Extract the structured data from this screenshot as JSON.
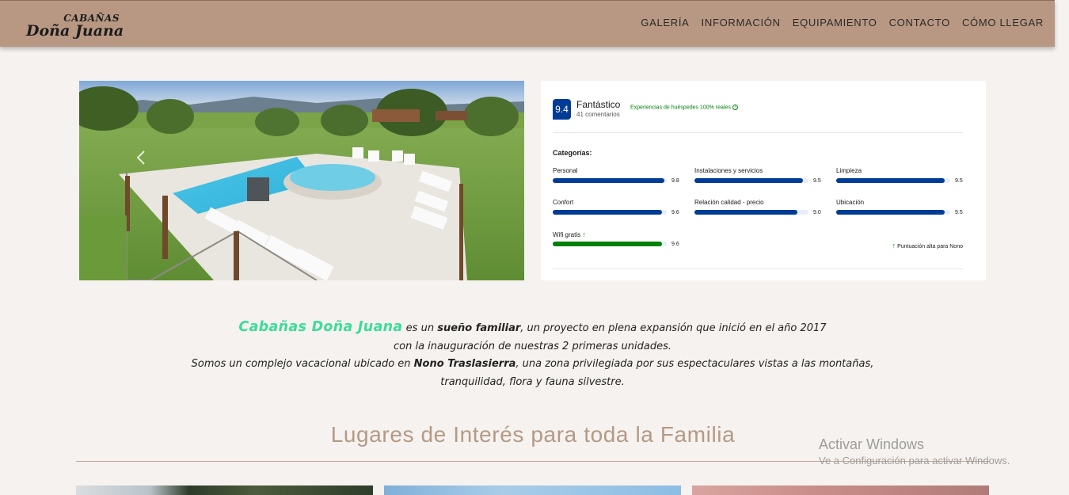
{
  "brand": {
    "small": "CABAÑAS",
    "big": "Doña Juana"
  },
  "nav": [
    "GALERÍA",
    "INFORMACIÓN",
    "EQUIPAMIENTO",
    "CONTACTO",
    "CÓMO LLEGAR"
  ],
  "reviews": {
    "score": "9.4",
    "score_word": "Fantástico",
    "review_count": "41 comentarios",
    "verified": "Experiencias de huéspedes 100% reales",
    "categories_title": "Categorías:",
    "categories": [
      {
        "label": "Personal",
        "value": "9.8",
        "fraction": 0.98
      },
      {
        "label": "Instalaciones y servicios",
        "value": "9.5",
        "fraction": 0.95
      },
      {
        "label": "Limpieza",
        "value": "9.5",
        "fraction": 0.95
      },
      {
        "label": "Confort",
        "value": "9.6",
        "fraction": 0.96
      },
      {
        "label": "Relación calidad - precio",
        "value": "9.0",
        "fraction": 0.9
      },
      {
        "label": "Ubicación",
        "value": "9.5",
        "fraction": 0.95
      },
      {
        "label": "Wifi gratis",
        "value": "9.6",
        "fraction": 0.96
      }
    ],
    "high_score_note": "Puntuación alta para Nono",
    "accent_color": "#003b95",
    "highlight_color": "#008009"
  },
  "intro": {
    "brand": "Cabañas Doña Juana",
    "part1": " es un ",
    "bold1": "sueño familiar",
    "part2": ", un proyecto en plena expansión que inició en el año 2017",
    "line2": "con la inauguración de nuestras 2 primeras unidades.",
    "part3": "Somos un complejo vacacional ubicado en ",
    "bold2": "Nono Traslasierra",
    "part4": ", una zona privilegiada por sus espectaculares vistas a las montañas,",
    "line4": "tranquilidad, flora y fauna silvestre."
  },
  "section_title": "Lugares de Interés para toda la Familia",
  "windows_notice": {
    "title": "Activar Windows",
    "subtitle": "Ve a Configuración para activar Windows."
  }
}
